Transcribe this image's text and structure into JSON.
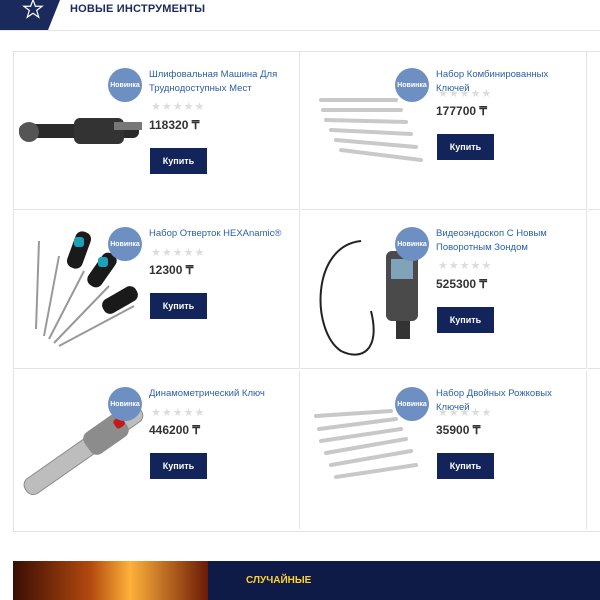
{
  "section": {
    "title": "НОВЫЕ ИНСТРУМЕНТЫ"
  },
  "badge_label": "Новинка",
  "buy_label": "Купить",
  "products": [
    {
      "name": "Шлифовальная Машина Для Труднодоступных Мест",
      "price": "118320 ₸",
      "icon": "angle-grinder-icon"
    },
    {
      "name": "Набор Комбинированных Ключей",
      "price": "177700 ₸",
      "icon": "wrench-set-icon"
    },
    {
      "name": "Набор Отверток HEXAnamic®",
      "price": "12300 ₸",
      "icon": "screwdriver-set-icon"
    },
    {
      "name": "Видеоэндоскоп С Новым Поворотным Зондом",
      "price": "525300 ₸",
      "icon": "endoscope-icon"
    },
    {
      "name": "Динамометрический Ключ",
      "price": "446200 ₸",
      "icon": "torque-wrench-icon"
    },
    {
      "name": "Набор Двойных Рожковых Ключей",
      "price": "35900 ₸",
      "icon": "open-end-wrench-set-icon"
    }
  ],
  "rating": {
    "filled": 0,
    "max": 5
  },
  "banner": {
    "title": "СЛУЧАЙНЫЕ"
  },
  "colors": {
    "accent": "#13245a",
    "link": "#2a5fa8",
    "badge": "#6d8fc2",
    "banner_title": "#ffd22e"
  }
}
